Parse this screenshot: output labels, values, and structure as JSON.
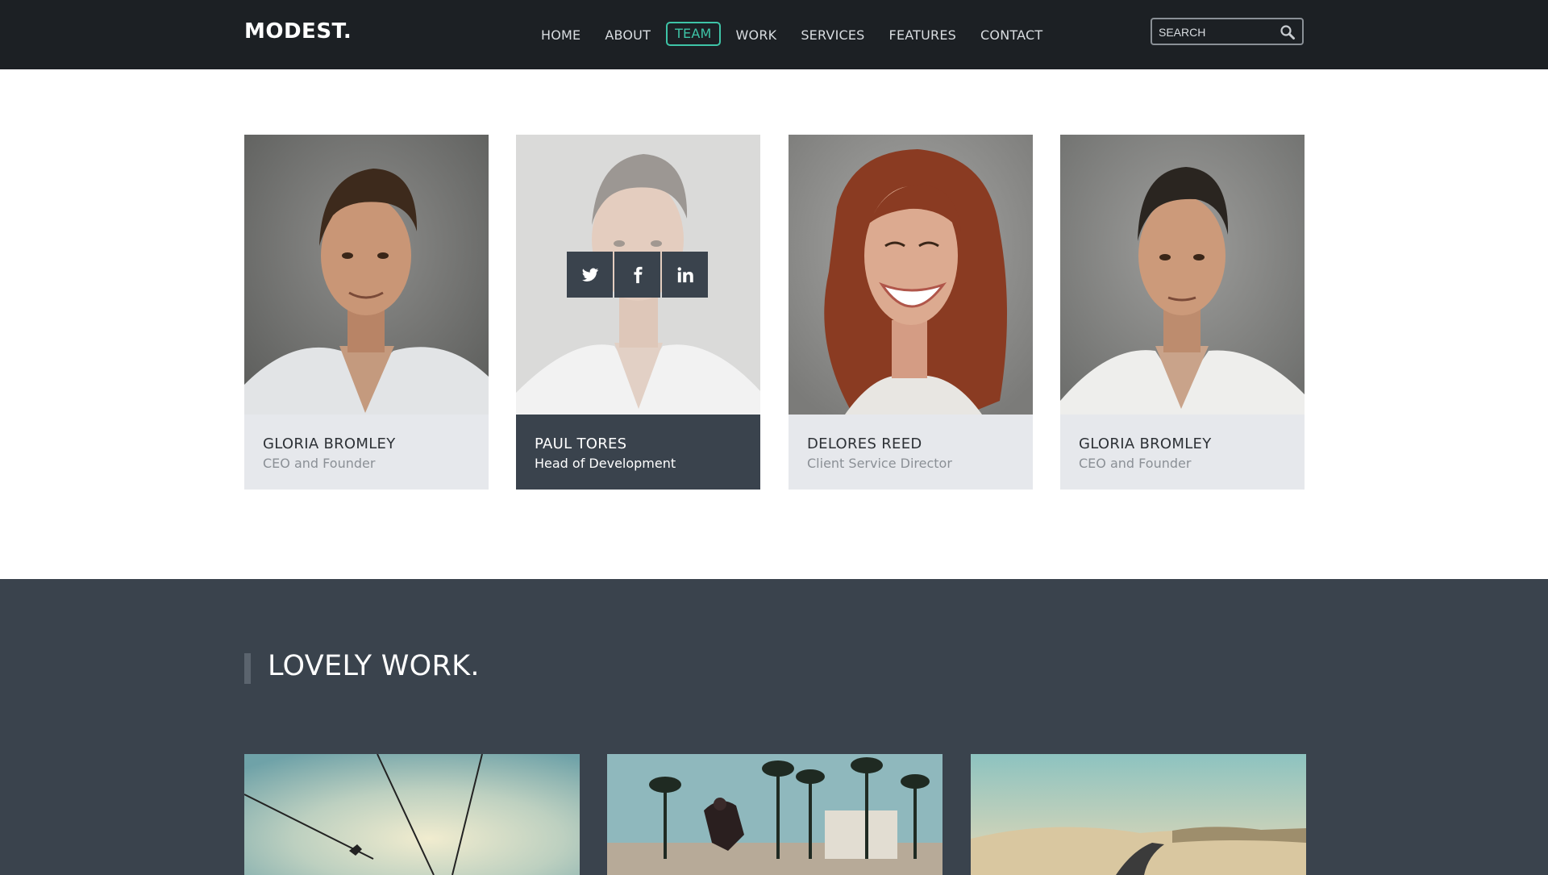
{
  "brand": {
    "logo": "MODEST."
  },
  "nav": {
    "items": [
      "HOME",
      "ABOUT",
      "TEAM",
      "WORK",
      "SERVICES",
      "FEATURES",
      "CONTACT"
    ],
    "active": "TEAM"
  },
  "search": {
    "placeholder": "SEARCH"
  },
  "team": {
    "members": [
      {
        "name": "GLORIA BROMLEY",
        "role": "CEO and Founder"
      },
      {
        "name": "PAUL TORES",
        "role": "Head of Development"
      },
      {
        "name": "DELORES REED",
        "role": "Client Service Director"
      },
      {
        "name": "GLORIA BROMLEY",
        "role": "CEO and Founder"
      }
    ],
    "social_icons": [
      "twitter-icon",
      "facebook-icon",
      "linkedin-icon"
    ]
  },
  "work": {
    "title": "LOVELY WORK."
  },
  "colors": {
    "nav_bg": "#1c2024",
    "accent": "#3ec4a7",
    "dark_panel": "#3a434d",
    "card_bg": "#e6e8ec"
  }
}
